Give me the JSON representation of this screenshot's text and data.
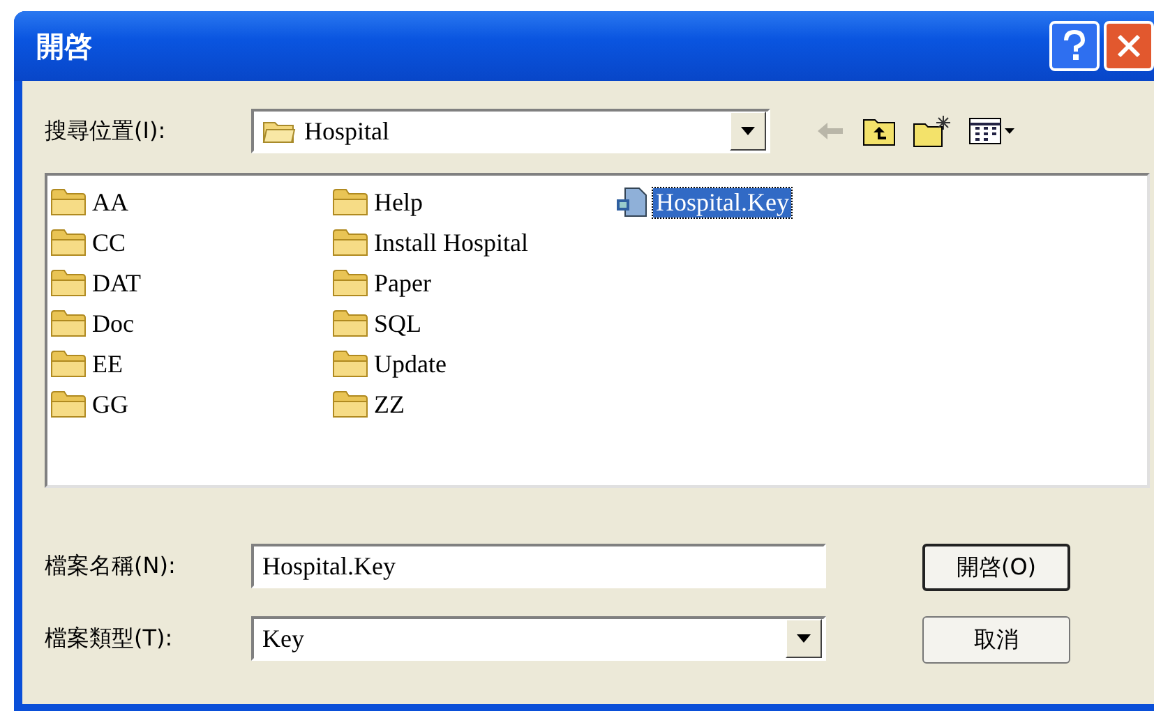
{
  "window": {
    "title": "開啓"
  },
  "look_in": {
    "label": "搜尋位置(I):",
    "value": "Hospital"
  },
  "items": [
    {
      "name": "AA",
      "kind": "folder",
      "selected": false
    },
    {
      "name": "CC",
      "kind": "folder",
      "selected": false
    },
    {
      "name": "DAT",
      "kind": "folder",
      "selected": false
    },
    {
      "name": "Doc",
      "kind": "folder",
      "selected": false
    },
    {
      "name": "EE",
      "kind": "folder",
      "selected": false
    },
    {
      "name": "GG",
      "kind": "folder",
      "selected": false
    },
    {
      "name": "Help",
      "kind": "folder",
      "selected": false
    },
    {
      "name": "Install Hospital",
      "kind": "folder",
      "selected": false
    },
    {
      "name": "Paper",
      "kind": "folder",
      "selected": false
    },
    {
      "name": "SQL",
      "kind": "folder",
      "selected": false
    },
    {
      "name": "Update",
      "kind": "folder",
      "selected": false
    },
    {
      "name": "ZZ",
      "kind": "folder",
      "selected": false
    },
    {
      "name": "Hospital.Key",
      "kind": "file",
      "selected": true
    }
  ],
  "file_name": {
    "label": "檔案名稱(N):",
    "value": "Hospital.Key"
  },
  "file_type": {
    "label": "檔案類型(T):",
    "value": "Key"
  },
  "buttons": [
    "開啓(O)",
    "取消"
  ]
}
